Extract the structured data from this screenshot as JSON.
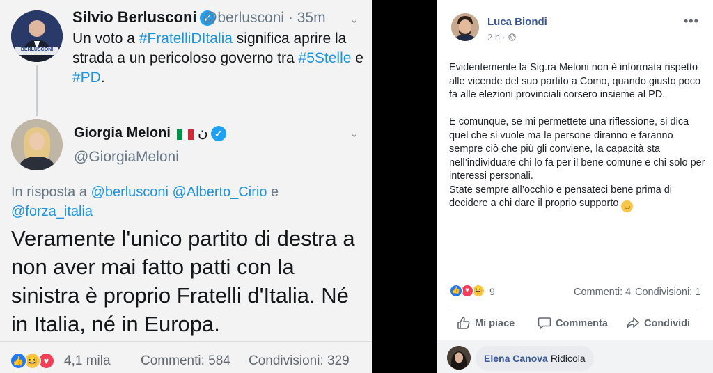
{
  "tweet_berlusconi": {
    "name": "Silvio Berlusconi",
    "handle": "@berlusconi",
    "time": "· 35m",
    "avatar_text": "BERLUSCONI",
    "text_1": "Un voto a ",
    "hashtag_1": "#FratelliDItalia",
    "text_2": " significa aprire la strada a un pericoloso governo tra ",
    "hashtag_2": "#5Stelle",
    "text_3": " e ",
    "hashtag_3": "#PD",
    "text_4": "."
  },
  "tweet_meloni": {
    "name": "Giorgia Meloni",
    "flag_suffix": "ن",
    "handle": "@GiorgiaMeloni",
    "reply_prefix": "In risposta a ",
    "reply_mention_1": "@berlusconi",
    "reply_mention_2": "@Alberto_Cirio",
    "reply_and": " e ",
    "reply_mention_3": "@forza_italia",
    "text": "Veramente l'unico partito di destra a non aver mai fatto patti con la sinistra è proprio Fratelli d'Italia. Né in Italia, né in Europa."
  },
  "left_footer": {
    "reaction_count": "4,1 mila",
    "comments": "Commenti: 584",
    "shares": "Condivisioni: 329"
  },
  "fb_post": {
    "author": "Luca Biondi",
    "time": "2 h ·",
    "more": "•••",
    "paragraph_1": "Evidentemente la Sig.ra Meloni non è informata rispetto alle vicende del suo partito a Como, quando giusto poco fa alle elezioni provinciali corsero insieme al PD.",
    "paragraph_2": "E comunque, se mi permettete una riflessione, si dica quel che si vuole ma le persone diranno e faranno sempre ciò che più gli conviene, la capacità sta nell’individuare chi lo fa per il bene comune e chi solo per interessi personali.",
    "paragraph_3": "State sempre all’occhio e pensateci bene prima di decidere a chi dare il proprio supporto",
    "reaction_count": "9",
    "comments": "Commenti: 4",
    "shares": "Condivisioni: 1",
    "actions": {
      "like": "Mi piace",
      "comment": "Commenta",
      "share": "Condividi"
    }
  },
  "comment": {
    "author": "Elena Canova",
    "text": "Ridicola"
  },
  "icons": {
    "verified": "verified-badge-icon",
    "like": "thumbs-up-icon",
    "comment": "speech-bubble-icon",
    "share": "share-arrow-icon",
    "globe": "globe-icon"
  },
  "colors": {
    "twitter_blue": "#1b95e0",
    "facebook_link": "#385898",
    "like_blue": "#2078f4",
    "love_red": "#f33e58",
    "haha_yellow": "#f7c64a"
  }
}
